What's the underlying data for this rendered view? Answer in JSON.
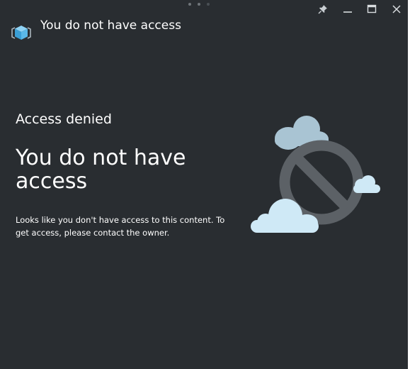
{
  "window": {
    "title": "You do not have access",
    "controls": {
      "pin_icon": "pin-icon",
      "minimize_icon": "minimize-icon",
      "maximize_icon": "maximize-icon",
      "close_icon": "close-icon"
    }
  },
  "content": {
    "subtitle": "Access denied",
    "headline": "You do not have access",
    "message": "Looks like you don't have access to this content. To get access, please contact the owner."
  },
  "colors": {
    "background": "#292d31",
    "text": "#ffffff",
    "cloud_light": "#cfe9f6",
    "cloud_muted": "#a9c4d3",
    "prohibit": "#5c6166",
    "app_icon_accent": "#5bb8e8"
  }
}
